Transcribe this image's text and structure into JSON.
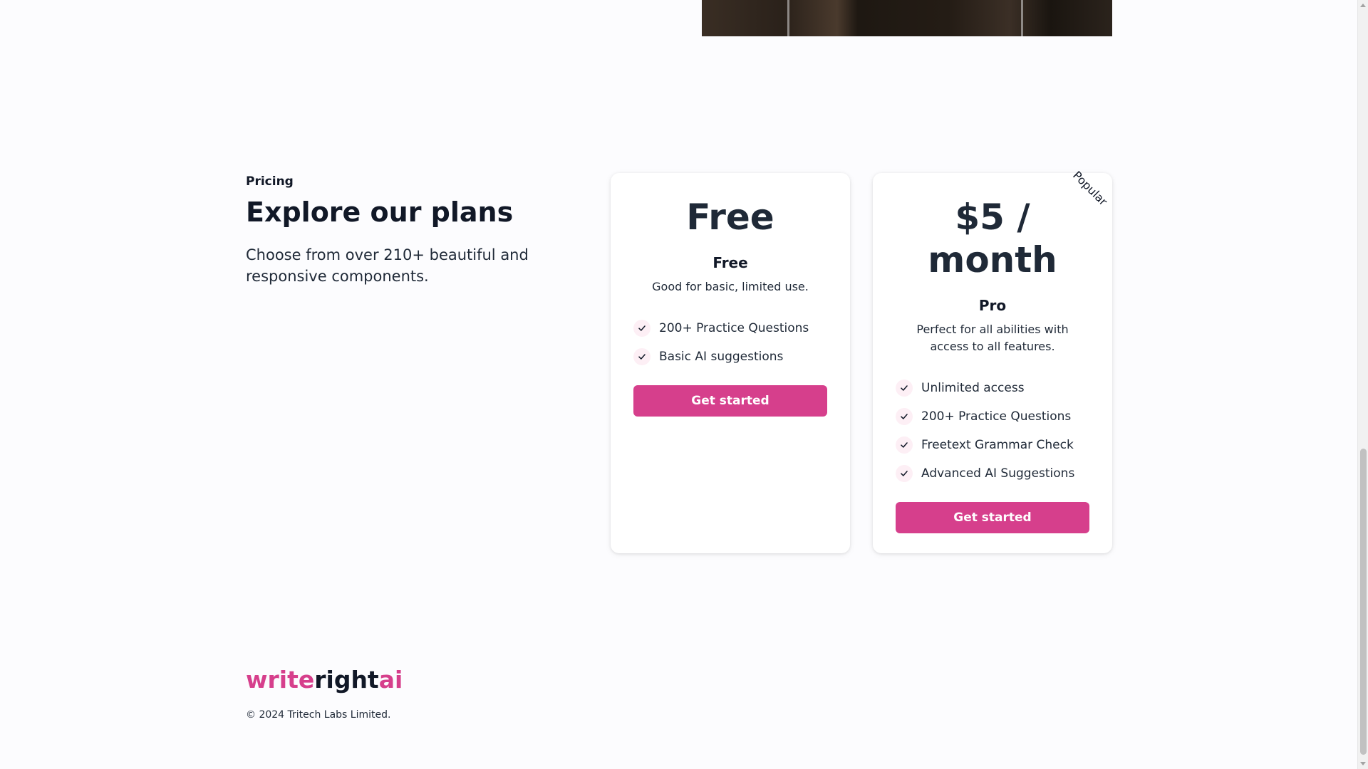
{
  "pricing": {
    "eyebrow": "Pricing",
    "title": "Explore our plans",
    "subtitle": "Choose from over 210+ beautiful and responsive components."
  },
  "plans": [
    {
      "price": "Free",
      "name": "Free",
      "description": "Good for basic, limited use.",
      "features": [
        "200+ Practice Questions",
        "Basic AI suggestions"
      ],
      "cta": "Get started"
    },
    {
      "price": "$5 / month",
      "name": "Pro",
      "description": "Perfect for all abilities with access to all features.",
      "badge": "Popular",
      "features": [
        "Unlimited access",
        "200+ Practice Questions",
        "Freetext Grammar Check",
        "Advanced AI Suggestions"
      ],
      "cta": "Get started"
    }
  ],
  "footer": {
    "brand_part1": "write",
    "brand_part2": "right",
    "brand_part3": "ai",
    "copyright": "© 2024 Tritech Labs Limited."
  },
  "icons": {
    "check": "check-icon"
  },
  "colors": {
    "accent": "#d63f8c",
    "check_bg": "#fdeff5",
    "text": "#111827",
    "background": "#fcfcfe"
  }
}
